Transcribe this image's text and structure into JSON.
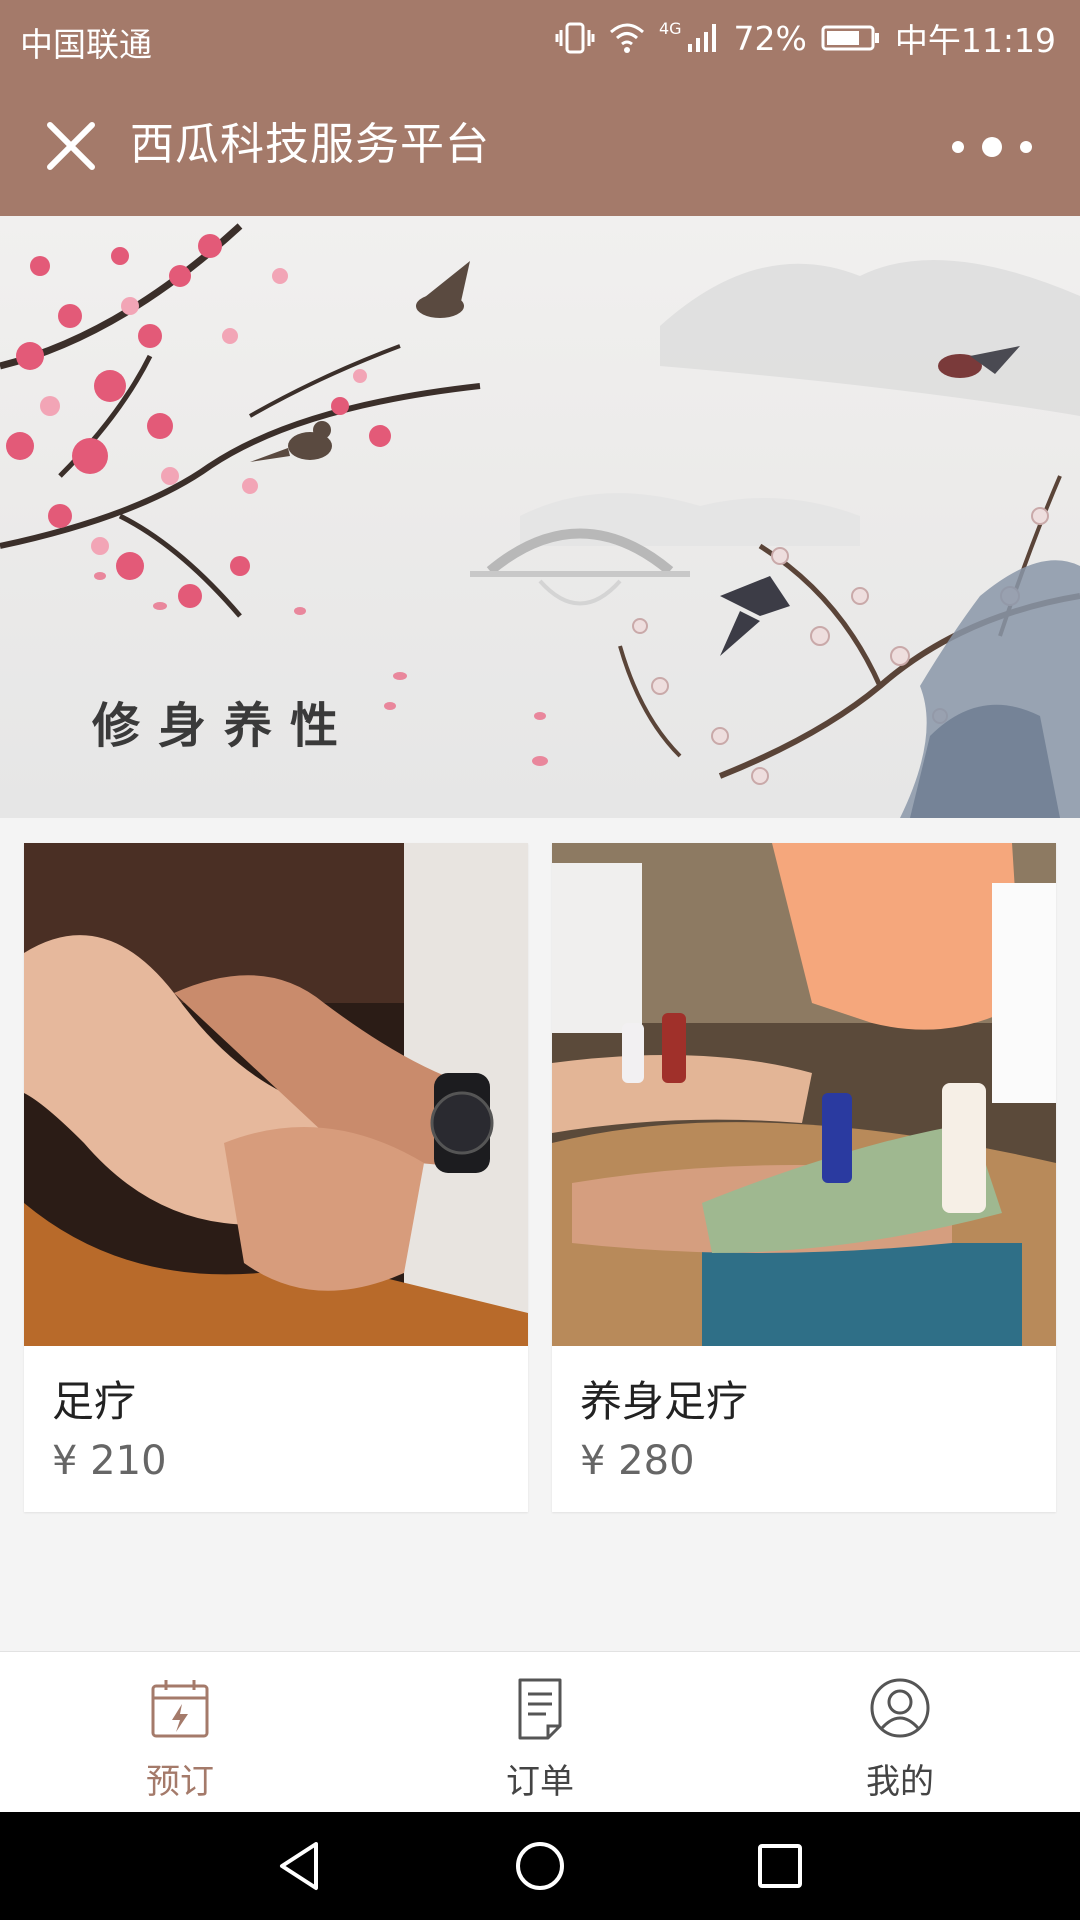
{
  "status_bar": {
    "carrier": "中国联通",
    "network": "4G",
    "battery": "72%",
    "time": "中午11:19"
  },
  "nav": {
    "title": "西瓜科技服务平台",
    "close_icon": "close-icon",
    "more_icon": "more-icon"
  },
  "banner": {
    "caption": "修身养性"
  },
  "products": [
    {
      "name": "足疗",
      "price": "¥ 210"
    },
    {
      "name": "养身足疗",
      "price": "¥ 280"
    }
  ],
  "tabbar": {
    "items": [
      {
        "label": "预订",
        "icon": "calendar-icon",
        "active": true
      },
      {
        "label": "订单",
        "icon": "document-icon",
        "active": false
      },
      {
        "label": "我的",
        "icon": "user-icon",
        "active": false
      }
    ]
  },
  "colors": {
    "brand": "#a47a6a",
    "background": "#f4f4f4"
  }
}
